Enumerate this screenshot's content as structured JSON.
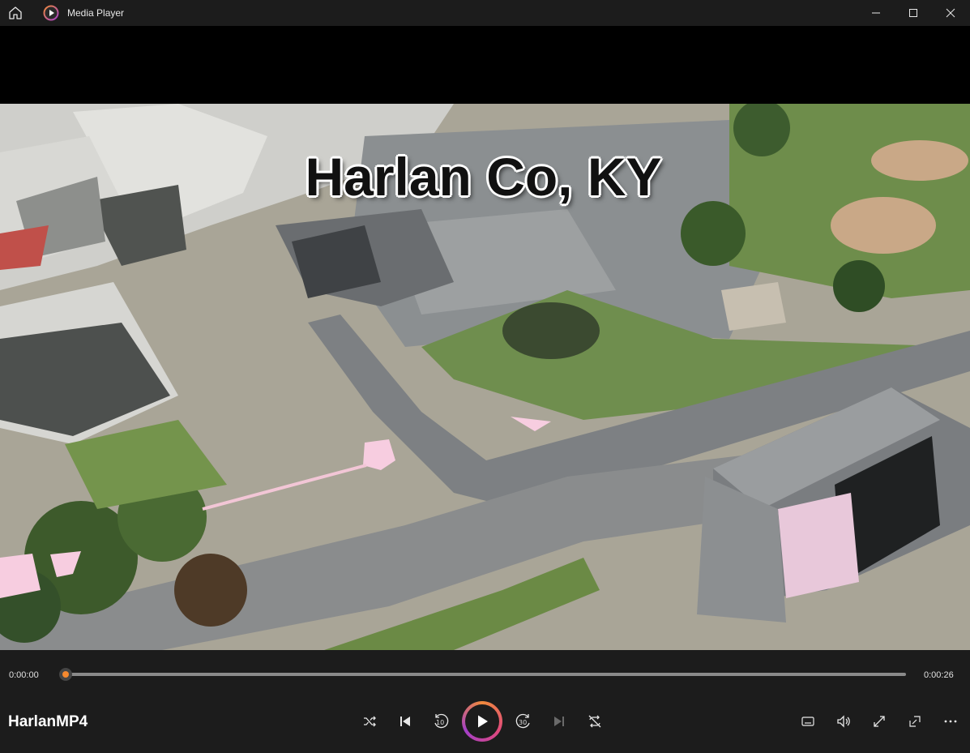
{
  "window": {
    "app_title": "Media Player"
  },
  "video": {
    "overlay_text": "Harlan Co, KY"
  },
  "playback": {
    "current_time": "0:00:00",
    "duration": "0:00:26",
    "progress": 0.0
  },
  "media": {
    "title": "HarlanMP4"
  },
  "controls": {
    "skip_back_seconds": "10",
    "skip_forward_seconds": "30"
  },
  "icons": [
    "home-icon",
    "app-icon",
    "minimize-icon",
    "maximize-icon",
    "close-icon",
    "shuffle-icon",
    "previous-icon",
    "skip-back-icon",
    "play-icon",
    "skip-forward-icon",
    "next-icon",
    "repeat-icon",
    "captions-icon",
    "volume-icon",
    "fullscreen-icon",
    "miniplayer-icon",
    "more-icon"
  ],
  "colors": {
    "accent_orange": "#f08a3c",
    "accent_pink": "#e0497c",
    "accent_purple": "#a33fc7",
    "chrome_bg": "#1c1c1c"
  }
}
